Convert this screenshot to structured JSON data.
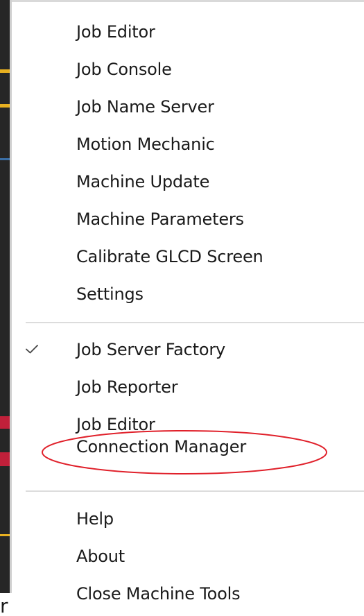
{
  "menu": {
    "group1": [
      {
        "label": "Job Editor"
      },
      {
        "label": "Job Console"
      },
      {
        "label": "Job Name Server"
      },
      {
        "label": "Motion Mechanic"
      },
      {
        "label": "Machine Update"
      },
      {
        "label": "Machine Parameters"
      },
      {
        "label": "Calibrate GLCD Screen"
      },
      {
        "label": "Settings"
      }
    ],
    "group2": [
      {
        "label": "Job Server Factory",
        "checked": true
      },
      {
        "label": "Job Reporter"
      },
      {
        "label": "Job Editor"
      },
      {
        "label": "Connection Manager",
        "highlighted": true
      }
    ],
    "group3": [
      {
        "label": "Help"
      },
      {
        "label": "About"
      },
      {
        "label": "Close Machine Tools"
      }
    ]
  },
  "background_fragment": "r",
  "colors": {
    "highlight": "#e0202a",
    "text": "#1a1a1a",
    "separator": "#dcdcdc"
  }
}
